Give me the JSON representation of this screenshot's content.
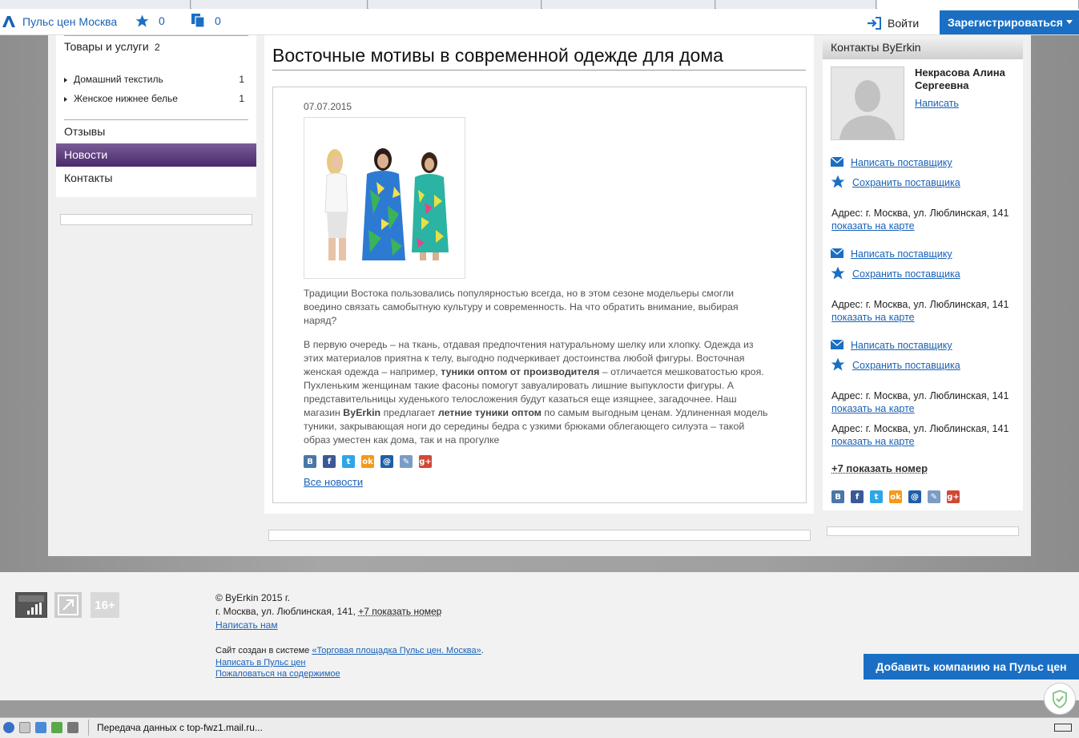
{
  "topbar": {
    "site_name": "Пульс цен Москва",
    "favorites_count": "0",
    "compare_count": "0",
    "login_label": "Войти",
    "register_label": "Зарегистрироваться"
  },
  "left": {
    "category_title": "Товары и услуги",
    "category_count": "2",
    "subcategories": [
      {
        "label": "Домашний текстиль",
        "count": "1"
      },
      {
        "label": "Женское нижнее белье",
        "count": "1"
      }
    ],
    "menu": [
      {
        "label": "Отзывы",
        "active": false
      },
      {
        "label": "Новости",
        "active": true
      },
      {
        "label": "Контакты",
        "active": false
      }
    ]
  },
  "article": {
    "title": "Восточные мотивы в современной одежде для дома",
    "date": "07.07.2015",
    "intro": "Традиции Востока пользовались популярностью всегда, но в этом сезоне модельеры смогли воедино связать самобытную культуру и современность. На что обратить внимание, выбирая наряд?",
    "body_1": "В первую очередь – на ткань, отдавая предпочтения натуральному шелку или хлопку. Одежда из этих материалов приятна к телу, выгодно подчеркивает достоинства любой фигуры. Восточная женская одежда – например, ",
    "body_bold_1": "туники оптом от производителя",
    "body_2": " – отличается мешковатостью кроя. Пухленьким женщинам такие фасоны помогут завуалировать лишние выпуклости фигуры. А представительницы худенького телосложения будут казаться еще изящнее, загадочнее. Наш магазин ",
    "body_bold_2": "ByErkin",
    "body_3": " предлагает ",
    "body_bold_3": "летние туники оптом",
    "body_4": " по самым выгодным ценам. Удлиненная модель туники, закрывающая ноги до середины бедра с узкими брюками облегающего силуэта – такой образ уместен как дома, так и на прогулке",
    "all_news": "Все новости"
  },
  "share": [
    {
      "icon": "vk-icon",
      "glyph": "B",
      "color": "#4a76a8"
    },
    {
      "icon": "facebook-icon",
      "glyph": "f",
      "color": "#3b5998"
    },
    {
      "icon": "twitter-icon",
      "glyph": "t",
      "color": "#2ea6e6"
    },
    {
      "icon": "odnoklassniki-icon",
      "glyph": "ok",
      "color": "#f39a1a"
    },
    {
      "icon": "mailru-icon",
      "glyph": "@",
      "color": "#1f5fa8"
    },
    {
      "icon": "livejournal-icon",
      "glyph": "✎",
      "color": "#7b9cc4"
    },
    {
      "icon": "googleplus-icon",
      "glyph": "g+",
      "color": "#d14836"
    }
  ],
  "contacts": {
    "header": "Контакты ByErkin",
    "person_name": "Некрасова Алина Сергеевна",
    "person_write": "Написать",
    "write_supplier": "Написать поставщику",
    "save_supplier": "Сохранить поставщика",
    "address_prefix": "Адрес: г. Москва, ул. Люблинская, 141",
    "show_on_map": "показать на карте",
    "phone": "+7 показать номер"
  },
  "footer": {
    "age_badge": "16+",
    "copyright": "© ByErkin 2015 г.",
    "address": "г. Москва, ул. Люблинская, 141,",
    "phone": "+7 показать номер",
    "write_us": "Написать нам",
    "created_prefix": "Сайт создан в системе ",
    "created_link": "«Торговая площадка Пульс цен. Москва»",
    "created_suffix": ".",
    "write_puls": "Написать в Пульс цен",
    "report": "Пожаловаться на содержимое",
    "add_company": "Добавить компанию на Пульс цен"
  },
  "status": {
    "text": "Передача данных с top-fwz1.mail.ru..."
  },
  "colors": {
    "accent": "#1a6fc4",
    "menu_active": "#5a3a7c",
    "link": "#1a62b5"
  }
}
